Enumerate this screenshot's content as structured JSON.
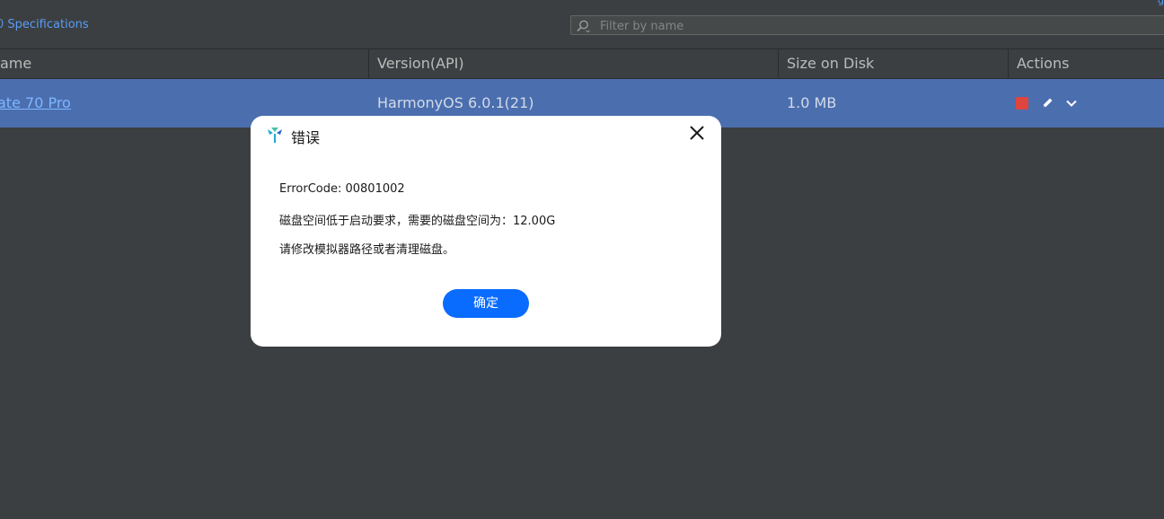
{
  "toolbar": {
    "spec_link": "Specifications",
    "spec_link_prefix": "0",
    "filter_placeholder": "Filter by name"
  },
  "table": {
    "columns": [
      "ame",
      "Version(API)",
      "Size on Disk",
      "Actions"
    ],
    "rows": [
      {
        "name": "ate 70 Pro",
        "version": "HarmonyOS 6.0.1(21)",
        "size": "1.0 MB"
      }
    ]
  },
  "dialog": {
    "title": "错误",
    "lines": [
      "ErrorCode: 00801002",
      "磁盘空间低于启动要求，需要的磁盘空间为：12.00G",
      "请修改模拟器路径或者清理磁盘。"
    ],
    "ok_label": "确定"
  },
  "colors": {
    "background": "#3c3f41",
    "selected_row": "#4b6eaf",
    "link": "#589df6",
    "primary_button": "#0a6cff",
    "stop": "#e0443e"
  },
  "icons": [
    "search-icon",
    "stop-icon",
    "pencil-icon",
    "chevron-down-icon",
    "logo-icon",
    "close-icon"
  ]
}
